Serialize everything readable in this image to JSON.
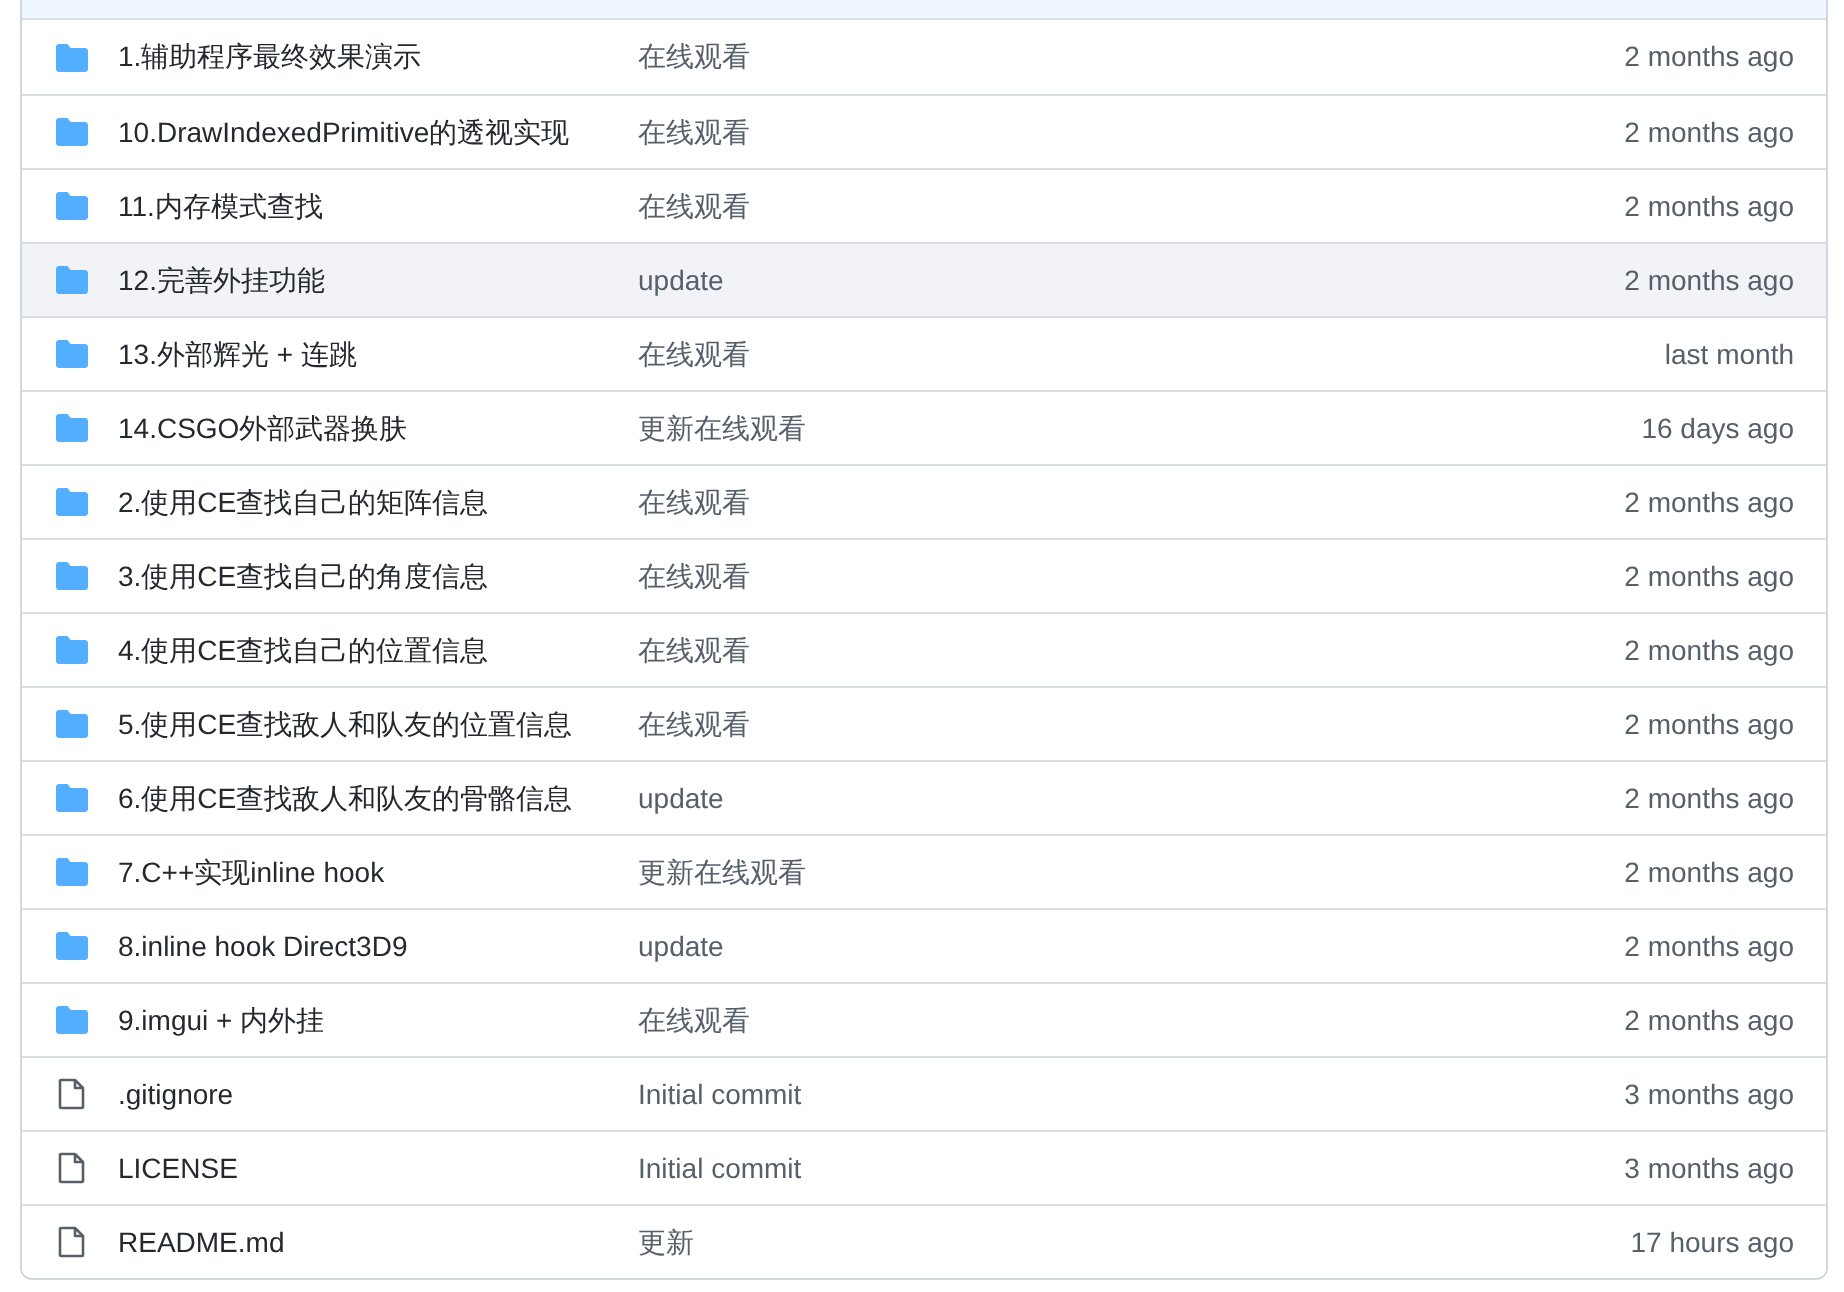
{
  "files": [
    {
      "kind": "folder",
      "name": "1.辅助程序最终效果演示",
      "message": "在线观看",
      "age": "2 months ago",
      "hovered": false
    },
    {
      "kind": "folder",
      "name": "10.DrawIndexedPrimitive的透视实现",
      "message": "在线观看",
      "age": "2 months ago",
      "hovered": false
    },
    {
      "kind": "folder",
      "name": "11.内存模式查找",
      "message": "在线观看",
      "age": "2 months ago",
      "hovered": false
    },
    {
      "kind": "folder",
      "name": "12.完善外挂功能",
      "message": "update",
      "age": "2 months ago",
      "hovered": true
    },
    {
      "kind": "folder",
      "name": "13.外部辉光 + 连跳",
      "message": "在线观看",
      "age": "last month",
      "hovered": false
    },
    {
      "kind": "folder",
      "name": "14.CSGO外部武器换肤",
      "message": "更新在线观看",
      "age": "16 days ago",
      "hovered": false
    },
    {
      "kind": "folder",
      "name": "2.使用CE查找自己的矩阵信息",
      "message": "在线观看",
      "age": "2 months ago",
      "hovered": false
    },
    {
      "kind": "folder",
      "name": "3.使用CE查找自己的角度信息",
      "message": "在线观看",
      "age": "2 months ago",
      "hovered": false
    },
    {
      "kind": "folder",
      "name": "4.使用CE查找自己的位置信息",
      "message": "在线观看",
      "age": "2 months ago",
      "hovered": false
    },
    {
      "kind": "folder",
      "name": "5.使用CE查找敌人和队友的位置信息",
      "message": "在线观看",
      "age": "2 months ago",
      "hovered": false
    },
    {
      "kind": "folder",
      "name": "6.使用CE查找敌人和队友的骨骼信息",
      "message": "update",
      "age": "2 months ago",
      "hovered": false
    },
    {
      "kind": "folder",
      "name": "7.C++实现inline hook",
      "message": "更新在线观看",
      "age": "2 months ago",
      "hovered": false
    },
    {
      "kind": "folder",
      "name": "8.inline hook Direct3D9",
      "message": "update",
      "age": "2 months ago",
      "hovered": false
    },
    {
      "kind": "folder",
      "name": "9.imgui + 内外挂",
      "message": "在线观看",
      "age": "2 months ago",
      "hovered": false
    },
    {
      "kind": "file",
      "name": ".gitignore",
      "message": "Initial commit",
      "age": "3 months ago",
      "hovered": false
    },
    {
      "kind": "file",
      "name": "LICENSE",
      "message": "Initial commit",
      "age": "3 months ago",
      "hovered": false
    },
    {
      "kind": "file",
      "name": "README.md",
      "message": "更新",
      "age": "17 hours ago",
      "hovered": false
    }
  ]
}
